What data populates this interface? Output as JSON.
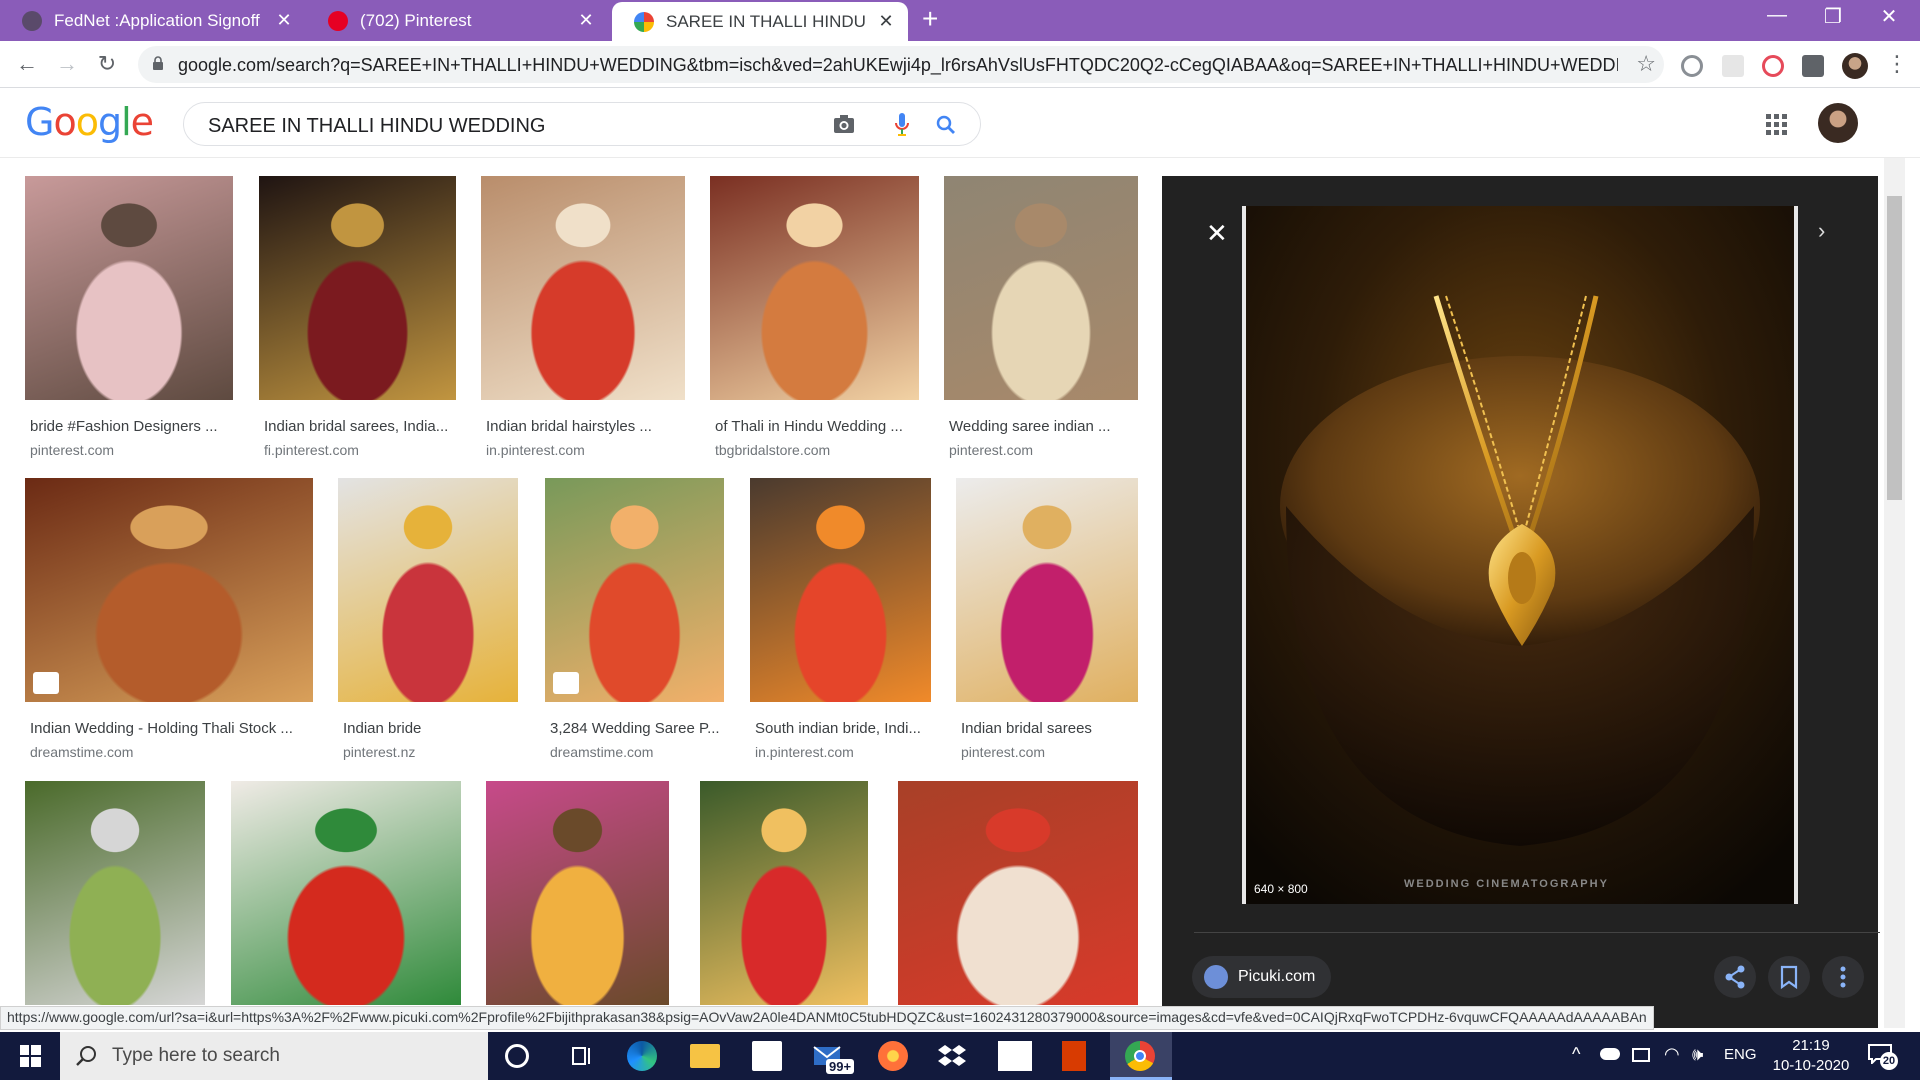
{
  "browser": {
    "tabs": [
      {
        "label": "FedNet :Application Signoff",
        "active": false
      },
      {
        "label": "(702) Pinterest",
        "active": false
      },
      {
        "label": "SAREE IN THALLI HINDU WEDDIN",
        "active": true
      }
    ],
    "new_tab": "+",
    "url": "google.com/search?q=SAREE+IN+THALLI+HINDU+WEDDING&tbm=isch&ved=2ahUKEwji4p_lr6rsAhVslUsFHTQDC20Q2-cCegQIABAA&oq=SAREE+IN+THALLI+HINDU+WEDDING&gs..."
  },
  "google": {
    "logo": [
      "G",
      "o",
      "o",
      "g",
      "l",
      "e"
    ],
    "logo_colors": [
      "#4285f4",
      "#ea4335",
      "#fbbc05",
      "#4285f4",
      "#34a853",
      "#ea4335"
    ],
    "query": "SAREE IN THALLI HINDU WEDDING"
  },
  "results": [
    {
      "caption": "bride #Fashion Designers ...",
      "source": "pinterest.com",
      "colors": [
        "#c89a9a",
        "#e7c2c4",
        "#5e4a40"
      ]
    },
    {
      "caption": "Indian bridal sarees, India...",
      "source": "fi.pinterest.com",
      "colors": [
        "#1f1412",
        "#7b1a1f",
        "#c19540"
      ]
    },
    {
      "caption": "Indian bridal hairstyles ...",
      "source": "in.pinterest.com",
      "colors": [
        "#b98d6b",
        "#d63b2a",
        "#f0e0c9"
      ]
    },
    {
      "caption": "of Thali in Hindu Wedding ...",
      "source": "tbgbridalstore.com",
      "colors": [
        "#7a2f22",
        "#d47b3f",
        "#f2d2a4"
      ]
    },
    {
      "caption": "Wedding saree indian ...",
      "source": "pinterest.com",
      "colors": [
        "#8f8573",
        "#e6d6b5",
        "#a8896a"
      ]
    },
    {
      "caption": "Indian Wedding - Holding Thali Stock ...",
      "source": "dreamstime.com",
      "colors": [
        "#6b2a14",
        "#b45c2b",
        "#d9a05a"
      ]
    },
    {
      "caption": "Indian bride",
      "source": "pinterest.nz",
      "colors": [
        "#e3e3e3",
        "#c9343c",
        "#e6b23a"
      ]
    },
    {
      "caption": "3,284 Wedding Saree P...",
      "source": "dreamstime.com",
      "colors": [
        "#78995a",
        "#e04a2b",
        "#f2b06a"
      ]
    },
    {
      "caption": "South indian bride, Indi...",
      "source": "in.pinterest.com",
      "colors": [
        "#4a3a2e",
        "#e5452a",
        "#f08a2a"
      ]
    },
    {
      "caption": "Indian bridal sarees",
      "source": "pinterest.com",
      "colors": [
        "#ececec",
        "#c21f6b",
        "#e0b060"
      ]
    },
    {
      "caption": "",
      "source": "",
      "colors": [
        "#4a6a2a",
        "#8fb054",
        "#d6d6d6"
      ]
    },
    {
      "caption": "",
      "source": "",
      "colors": [
        "#f0ebe6",
        "#d42a1e",
        "#2f8a3a"
      ]
    },
    {
      "caption": "",
      "source": "",
      "colors": [
        "#c74a8a",
        "#f0b040",
        "#6a4a2a"
      ]
    },
    {
      "caption": "",
      "source": "",
      "colors": [
        "#3a5a2a",
        "#d82a2a",
        "#f0c060"
      ]
    },
    {
      "caption": "",
      "source": "",
      "colors": [
        "#a84028",
        "#f0e0d0",
        "#d83a2a"
      ]
    }
  ],
  "preview": {
    "dimensions": "640 × 800",
    "watermark": "WEDDING CINEMATOGRAPHY",
    "source": "Picuki.com"
  },
  "status_url": "https://www.google.com/url?sa=i&url=https%3A%2F%2Fwww.picuki.com%2Fprofile%2Fbijithprakasan38&psig=AOvVaw2A0le4DANMt0C5tubHDQZC&ust=1602431280379000&source=images&cd=vfe&ved=0CAIQjRxqFwoTCPDHz-6vquwCFQAAAAAdAAAAABAn",
  "taskbar": {
    "search_placeholder": "Type here to search",
    "mail_badge": "99+",
    "language": "ENG",
    "time": "21:19",
    "date": "10-10-2020",
    "notifications": "20"
  }
}
